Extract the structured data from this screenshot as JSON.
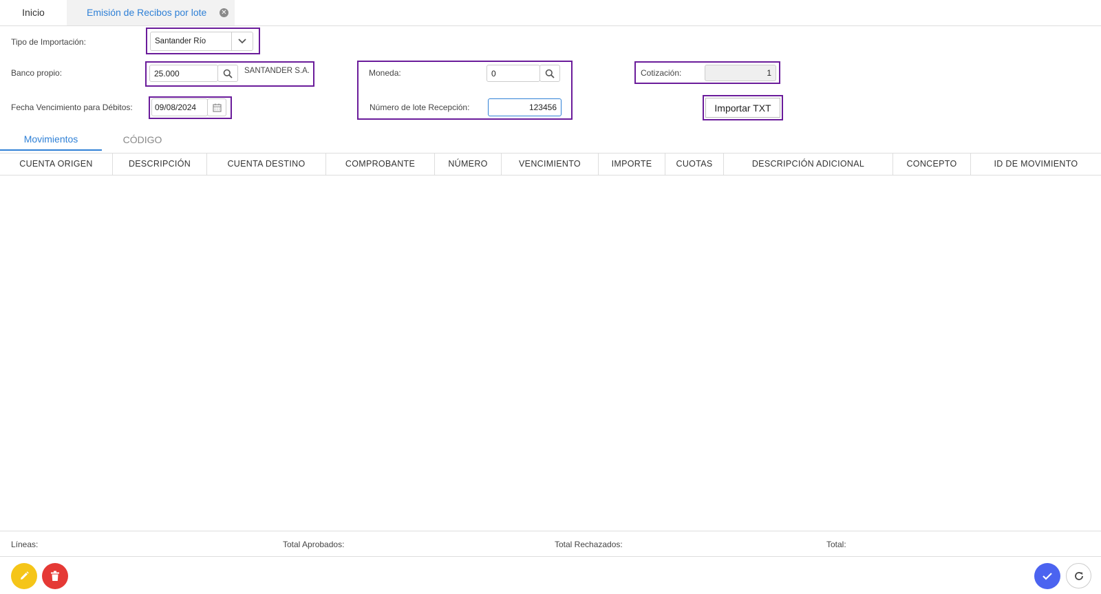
{
  "tabs": {
    "home_label": "Inicio",
    "active_label": "Emisión de Recibos por lote",
    "close_glyph": "✕"
  },
  "form": {
    "tipo_importacion": {
      "label": "Tipo de Importación:",
      "value": "Santander Río"
    },
    "banco_propio": {
      "label": "Banco propio:",
      "value": "25.000",
      "name": "SANTANDER S.A."
    },
    "fecha_vencimiento": {
      "label": "Fecha Vencimiento para Débitos:",
      "value": "09/08/2024"
    },
    "moneda": {
      "label": "Moneda:",
      "value": "0"
    },
    "numero_lote": {
      "label": "Número de lote Recepción:",
      "value": "123456"
    },
    "cotizacion": {
      "label": "Cotización:",
      "value": "1"
    },
    "importar_button": "Importar TXT"
  },
  "section_tabs": [
    {
      "label": "Movimientos",
      "active": true
    },
    {
      "label": "CÓDIGO",
      "active": false
    }
  ],
  "table": {
    "columns": [
      "CUENTA ORIGEN",
      "DESCRIPCIÓN",
      "CUENTA DESTINO",
      "COMPROBANTE",
      "NÚMERO",
      "VENCIMIENTO",
      "IMPORTE",
      "CUOTAS",
      "DESCRIPCIÓN ADICIONAL",
      "CONCEPTO",
      "ID DE MOVIMIENTO"
    ],
    "rows": []
  },
  "totals": {
    "lineas": "Líneas:",
    "aprobados": "Total Aprobados:",
    "rechazados": "Total Rechazados:",
    "total": "Total:"
  },
  "colors": {
    "accent": "#2f80d6",
    "highlight": "#6a1b9a",
    "edit": "#f5c518",
    "delete": "#e53935",
    "confirm": "#4b63f0"
  },
  "icons": {
    "edit": "pencil-icon",
    "delete": "trash-icon",
    "confirm": "check-icon",
    "refresh": "refresh-icon"
  }
}
